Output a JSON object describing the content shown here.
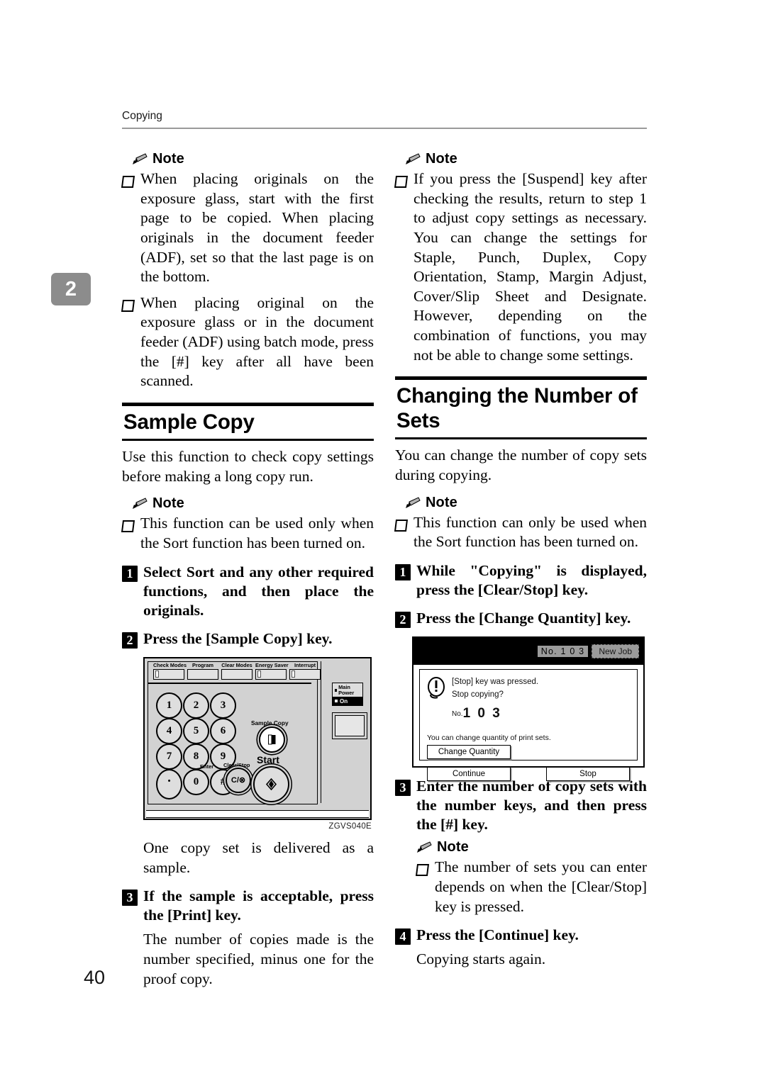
{
  "page": {
    "running_header": "Copying",
    "page_number": "40",
    "chapter_tab": "2"
  },
  "left_column": {
    "note1": {
      "label": "Note",
      "items": [
        "When placing originals on the exposure glass, start with the first page to be copied. When placing originals in the document feeder (ADF), set so that the last page is on the bottom.",
        "When placing original on the exposure glass or in the document feeder (ADF) using batch mode, press the [#] key after all have been scanned."
      ]
    },
    "section": {
      "title": "Sample Copy",
      "intro": "Use this function to check copy settings before making a long copy run.",
      "note": {
        "label": "Note",
        "items": [
          "This function can be used only when the Sort function has been turned on."
        ]
      },
      "steps": [
        {
          "num": "1",
          "text": "Select Sort and any other required functions, and then place the originals."
        },
        {
          "num": "2",
          "text": "Press the [Sample Copy] key."
        },
        {
          "num": "3",
          "text": "If the sample is acceptable, press the [Print] key."
        }
      ],
      "after_figure_text": "One copy set is delivered as a sample.",
      "step3_sub": "The number of copies made is the number specified, minus one for the proof copy."
    },
    "figure": {
      "code": "ZGVS040E",
      "top_buttons": [
        "Check Modes",
        "Program",
        "Clear Modes",
        "Energy Saver",
        "Interrupt"
      ],
      "keypad": [
        "1",
        "2",
        "3",
        "4",
        "5",
        "6",
        "7",
        "8",
        "9",
        "·",
        "0",
        "#"
      ],
      "enter_label": "Enter",
      "clear_stop_label": "Clear/Stop",
      "clear_stop_key": "C/⊗",
      "sample_copy_label": "Sample Copy",
      "start_label": "Start",
      "main_power_label": "Main Power",
      "power_on_label": "On"
    }
  },
  "right_column": {
    "note1": {
      "label": "Note",
      "items": [
        "If you press the [Suspend] key after checking the results, return to step 1 to adjust copy settings as necessary. You can change the settings for Staple, Punch, Duplex, Copy Orientation, Stamp, Margin Adjust, Cover/Slip Sheet and Designate. However, depending on the combination of functions, you may not be able to change some settings."
      ]
    },
    "section": {
      "title": "Changing the Number of Sets",
      "intro": "You can change the number of copy sets during copying.",
      "note": {
        "label": "Note",
        "items": [
          "This function can only be used when the Sort function has been turned on."
        ]
      },
      "steps": [
        {
          "num": "1",
          "text": "While \"Copying\" is displayed, press the [Clear/Stop] key."
        },
        {
          "num": "2",
          "text": "Press the [Change Quantity] key."
        },
        {
          "num": "3",
          "text": "Enter the number of copy sets with the number keys, and then press the [#] key."
        },
        {
          "num": "4",
          "text": "Press the [Continue] key."
        }
      ],
      "step3_note": {
        "label": "Note",
        "items": [
          "The number of sets you can enter depends on when the [Clear/Stop] key is pressed."
        ]
      },
      "step4_sub": "Copying starts again."
    },
    "lcd_figure": {
      "job_no": "No. 1 0 3",
      "new_job": "New Job",
      "message_line1": "[Stop] key was pressed.",
      "message_line2": "Stop copying?",
      "number_prefix": "No.",
      "number_value": "1 0 3",
      "hint": "You can change quantity of print sets.",
      "btn_change_quantity": "Change Quantity",
      "btn_continue": "Continue",
      "btn_stop": "Stop"
    }
  }
}
